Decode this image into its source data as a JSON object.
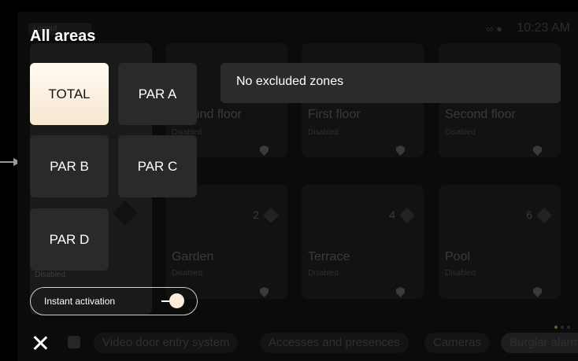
{
  "status_bar": {
    "time": "10:23 AM",
    "icons": "∞ ●"
  },
  "background": {
    "logout_label": "Logout",
    "cards": [
      {
        "name": "Ground floor",
        "state": "Disabled"
      },
      {
        "name": "First floor",
        "state": "Disabled"
      },
      {
        "name": "Second floor",
        "state": "Disabled"
      },
      {
        "name": "Garden",
        "state": "Disabled",
        "count": "2"
      },
      {
        "name": "Terrace",
        "state": "Disabled",
        "count": "4"
      },
      {
        "name": "Pool",
        "state": "Disabled",
        "count": "6"
      }
    ],
    "side_state": "Disabled",
    "nav": [
      "Video door entry system",
      "Accesses and presences",
      "Cameras",
      "Burglar alarm"
    ]
  },
  "overlay": {
    "title": "All areas",
    "tiles": [
      "TOTAL",
      "PAR A",
      "PAR B",
      "PAR C",
      "PAR D"
    ],
    "active_tile": "TOTAL",
    "banner": "No excluded zones",
    "instant_activation": {
      "label": "Instant activation",
      "enabled": true
    }
  },
  "colors": {
    "accent": "#fbeed9",
    "tile_bg": "#2a2a2a",
    "background": "#0b0b0b"
  }
}
